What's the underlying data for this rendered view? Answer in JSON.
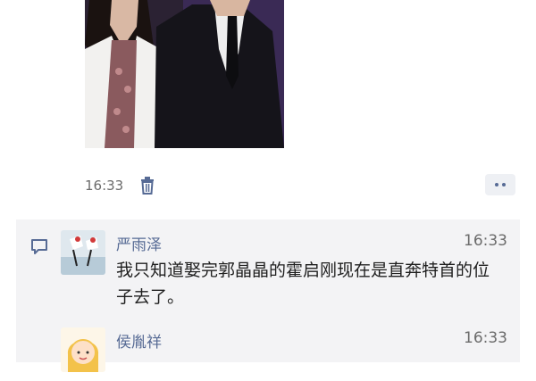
{
  "post": {
    "time": "16:33"
  },
  "icons": {
    "delete": "trash-icon",
    "more": "more-dots-icon",
    "comment": "comment-icon"
  },
  "comments": [
    {
      "name": "严雨泽",
      "time": "16:33",
      "text": "我只知道娶完郭晶晶的霍启刚现在是直奔特首的位子去了。"
    },
    {
      "name": "侯胤祥",
      "time": "16:33",
      "text": ""
    }
  ],
  "colors": {
    "link": "#576b95",
    "comment_bg": "#f3f3f5"
  }
}
